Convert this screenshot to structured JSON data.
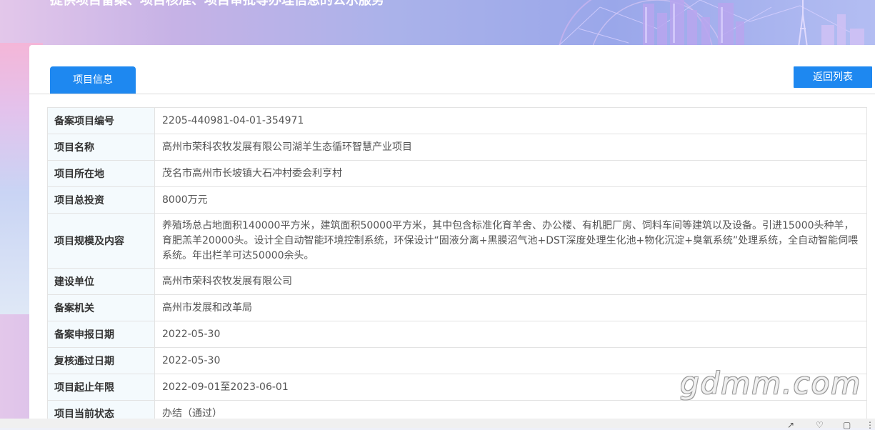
{
  "banner": {
    "subtitle": "提供项目备案、项目核准、项目审批等办理信息的公示服务"
  },
  "tabs": [
    {
      "label": "项目信息",
      "active": true
    }
  ],
  "back_button_label": "返回列表",
  "info": {
    "rows": [
      {
        "label": "备案项目编号",
        "value": "2205-440981-04-01-354971"
      },
      {
        "label": "项目名称",
        "value": "高州市荣科农牧发展有限公司湖羊生态循环智慧产业项目"
      },
      {
        "label": "项目所在地",
        "value": "茂名市高州市长坡镇大石冲村委会利亨村"
      },
      {
        "label": "项目总投资",
        "value": "8000万元"
      },
      {
        "label": "项目规模及内容",
        "value": "养殖场总占地面积140000平方米，建筑面积50000平方米，其中包含标准化育羊舍、办公楼、有机肥厂房、饲料车间等建筑以及设备。引进15000头种羊，育肥羔羊20000头。设计全自动智能环境控制系统，环保设计“固液分离+黑膜沼气池+DST深度处理生化池+物化沉淀+臭氧系统”处理系统，全自动智能伺喂系统。年出栏羊可达50000余头。"
      },
      {
        "label": "建设单位",
        "value": "高州市荣科农牧发展有限公司"
      },
      {
        "label": "备案机关",
        "value": "高州市发展和改革局"
      },
      {
        "label": "备案申报日期",
        "value": "2022-05-30"
      },
      {
        "label": "复核通过日期",
        "value": "2022-05-30"
      },
      {
        "label": "项目起止年限",
        "value": "2022-09-01至2023-06-01"
      },
      {
        "label": "项目当前状态",
        "value": "办结（通过）"
      }
    ]
  },
  "watermark": "gdmm.com",
  "colors": {
    "primary": "#1e88f0",
    "label_bg": "#f4fafd",
    "border": "#e3e3e3"
  }
}
